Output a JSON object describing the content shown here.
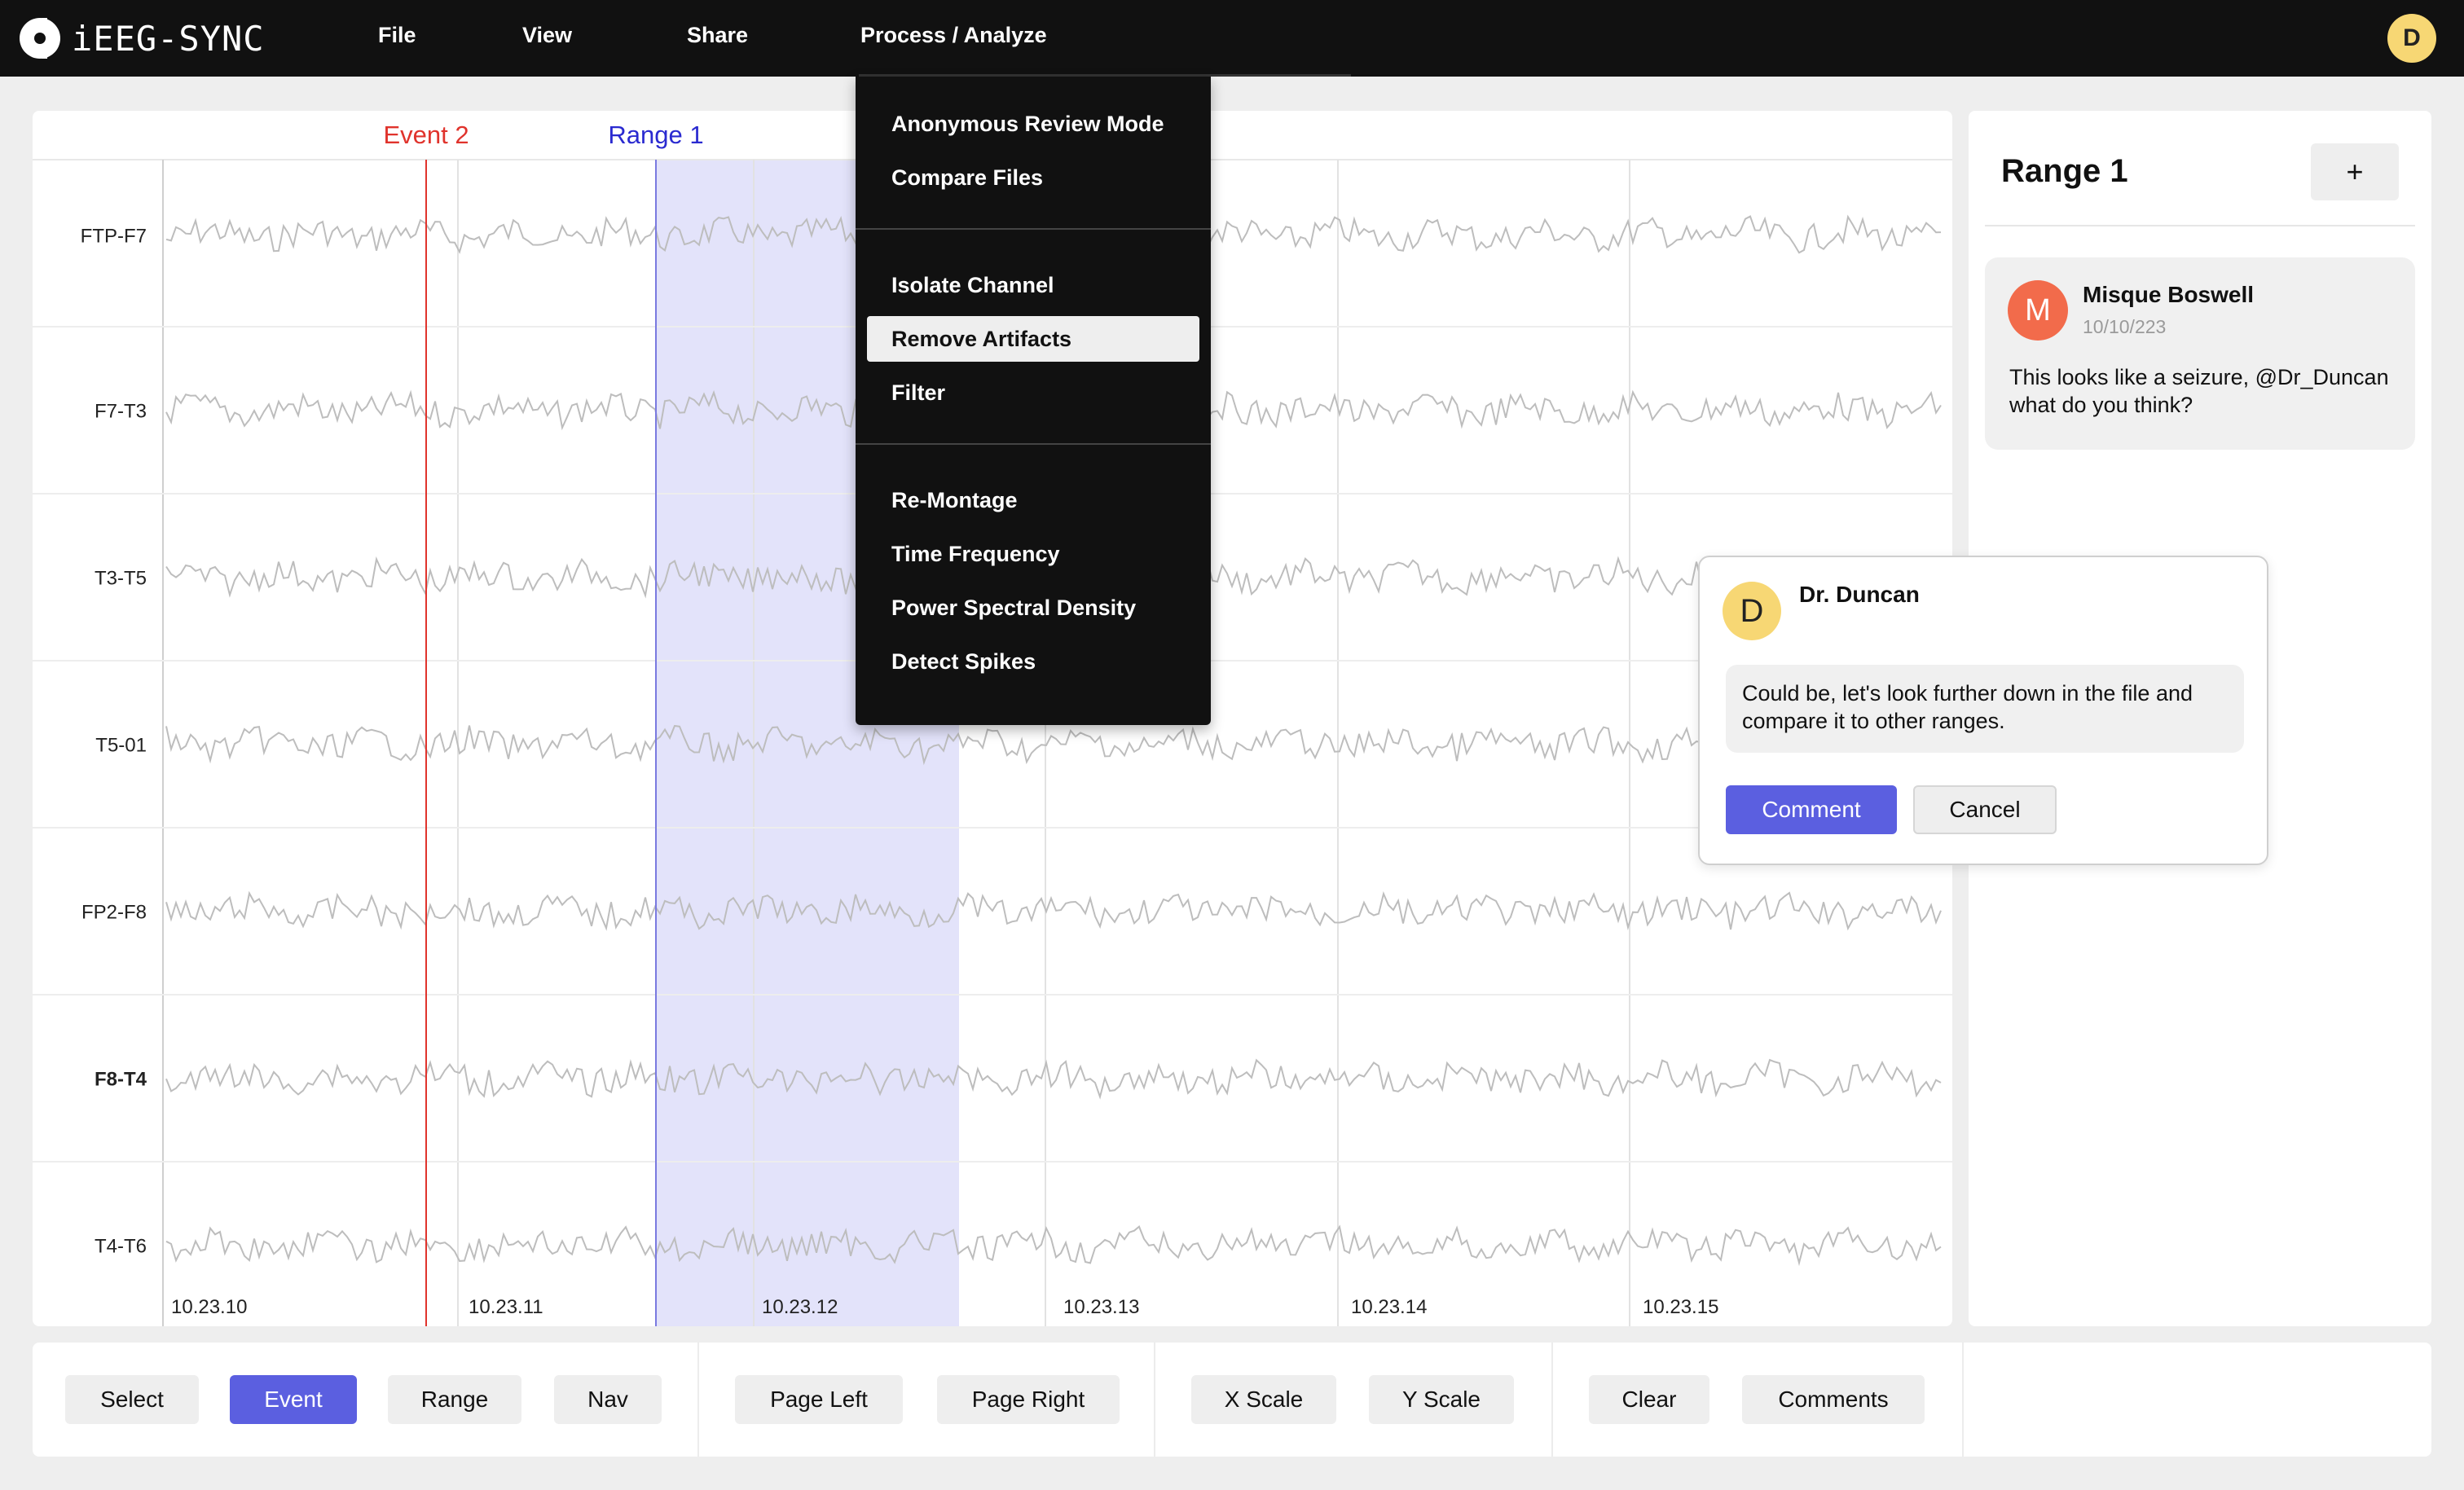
{
  "app": {
    "name": "iEEG-SYNC"
  },
  "nav": {
    "menus": [
      "File",
      "View",
      "Share",
      "Process / Analyze"
    ],
    "user_initial": "D"
  },
  "dropdown": {
    "groups": [
      [
        "Anonymous Review Mode",
        "Compare Files"
      ],
      [
        "Isolate Channel",
        "Remove Artifacts",
        "Filter"
      ],
      [
        "Re-Montage",
        "Time Frequency",
        "Power Spectral Density",
        "Detect Spikes"
      ]
    ],
    "active_item": "Remove Artifacts"
  },
  "viewer": {
    "channels": [
      "FTP-F7",
      "F7-T3",
      "T3-T5",
      "T5-01",
      "FP2-F8",
      "F8-T4",
      "T4-T6"
    ],
    "selected_channel": "F8-T4",
    "time_labels": [
      "10.23.10",
      "10.23.11",
      "10.23.12",
      "10.23.13",
      "10.23.14",
      "10.23.15"
    ],
    "event_marker": {
      "label": "Event 2",
      "color": "#e0332c"
    },
    "range_marker": {
      "label": "Range 1",
      "color": "#2a2ad0",
      "fill": "#e3e3fa"
    },
    "trace_color": "#bdbdbd"
  },
  "side_panel": {
    "title": "Range 1",
    "add_label": "+",
    "comment": {
      "author_initial": "M",
      "author": "Misque Boswell",
      "date": "10/10/223",
      "text": "This looks like a seizure, @Dr_Duncan what do you think?"
    }
  },
  "reply": {
    "author_initial": "D",
    "author": "Dr. Duncan",
    "text": "Could be, let's look further down in the file and compare it to other ranges.",
    "comment_label": "Comment",
    "cancel_label": "Cancel"
  },
  "toolbar": {
    "buttons": [
      "Select",
      "Event",
      "Range",
      "Nav",
      "Page Left",
      "Page Right",
      "X Scale",
      "Y Scale",
      "Clear",
      "Comments"
    ],
    "active": "Event"
  },
  "colors": {
    "accent": "#5b5fe0",
    "topbar": "#111111",
    "background": "#eeeeee"
  }
}
